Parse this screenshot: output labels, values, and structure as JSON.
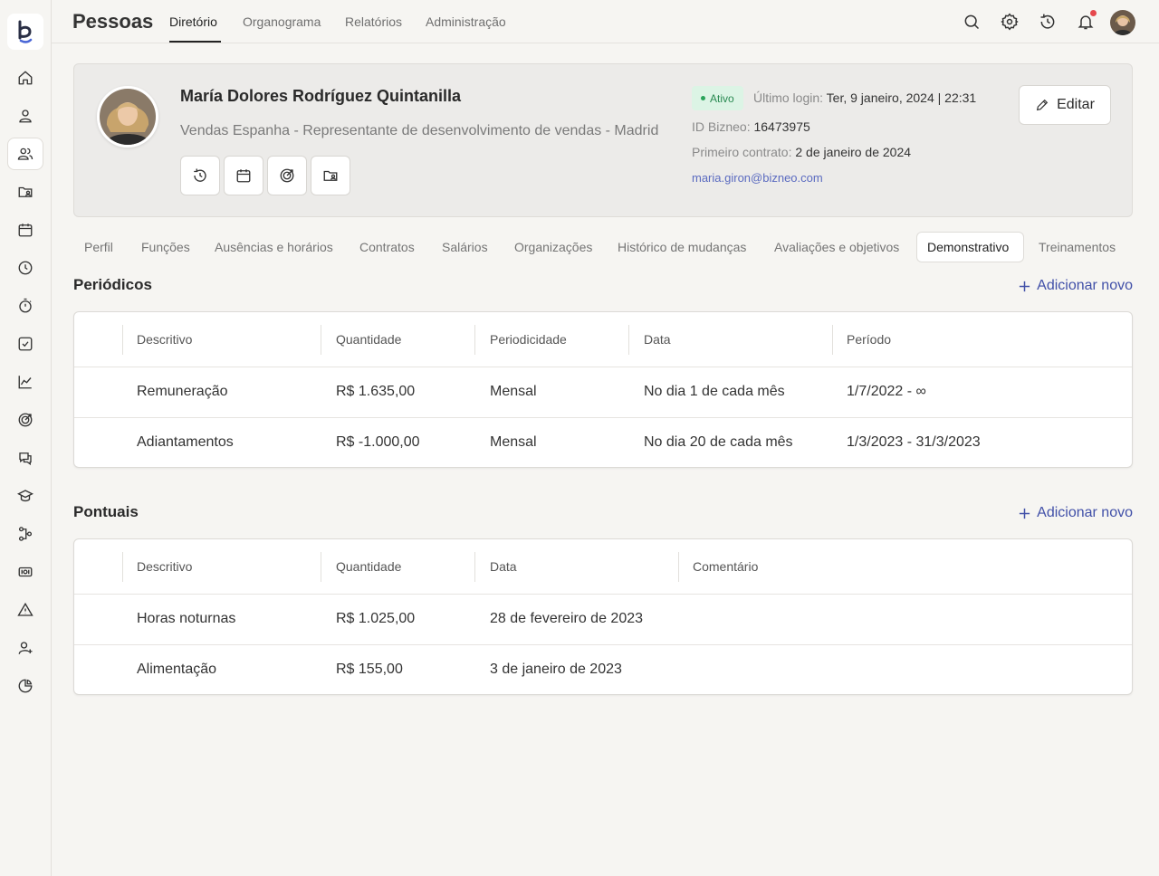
{
  "app": {
    "title": "Pessoas",
    "top_tabs": [
      "Diretório",
      "Organograma",
      "Relatórios",
      "Administração"
    ],
    "active_top_tab": "Diretório"
  },
  "sidebar": {
    "icons": [
      "home-icon",
      "user-icon",
      "users-icon",
      "folder-user-icon",
      "calendar-icon",
      "clock-icon",
      "timer-icon",
      "check-square-icon",
      "chart-line-icon",
      "target-icon",
      "chat-icon",
      "graduation-cap-icon",
      "org-chart-icon",
      "money-icon",
      "warning-icon",
      "user-plus-icon",
      "pie-chart-icon"
    ],
    "active": "users-icon"
  },
  "topbar_icons": [
    "search-icon",
    "settings-icon",
    "history-icon",
    "bell-icon"
  ],
  "profile": {
    "name": "María Dolores Rodríguez Quintanilla",
    "role": "Vendas Espanha - Representante de desenvolvimento de vendas - Madrid",
    "status": "Ativo",
    "last_login_label": "Último login:",
    "last_login_value": "Ter, 9 janeiro, 2024 | 22:31",
    "id_label": "ID Bizneo:",
    "id_value": "16473975",
    "first_contract_label": "Primeiro contrato:",
    "first_contract_value": "2 de janeiro de 2024",
    "email": "maria.giron@bizneo.com",
    "edit_label": "Editar",
    "action_icons": [
      "history-icon",
      "calendar-icon",
      "target-icon",
      "folder-user-icon"
    ]
  },
  "tabs": [
    "Perfil",
    "Funções",
    "Ausências e horários",
    "Contratos",
    "Salários",
    "Organizações",
    "Histórico de mudanças",
    "Avaliações e objetivos",
    "Demonstrativo",
    "Treinamentos"
  ],
  "active_tab": "Demonstrativo",
  "periodicos": {
    "title": "Periódicos",
    "add_label": "Adicionar novo",
    "headers": [
      "Descritivo",
      "Quantidade",
      "Periodicidade",
      "Data",
      "Período"
    ],
    "rows": [
      [
        "Remuneração",
        "R$ 1.635,00",
        "Mensal",
        "No dia 1 de cada mês",
        "1/7/2022 - ∞"
      ],
      [
        "Adiantamentos",
        "R$ -1.000,00",
        "Mensal",
        "No dia 20 de cada mês",
        "1/3/2023 - 31/3/2023"
      ]
    ]
  },
  "pontuais": {
    "title": "Pontuais",
    "add_label": "Adicionar novo",
    "headers": [
      "Descritivo",
      "Quantidade",
      "Data",
      "Comentário"
    ],
    "rows": [
      [
        "Horas noturnas",
        "R$ 1.025,00",
        "28 de fevereiro de 2023",
        ""
      ],
      [
        "Alimentação",
        "R$ 155,00",
        "3 de janeiro de 2023",
        ""
      ]
    ]
  }
}
